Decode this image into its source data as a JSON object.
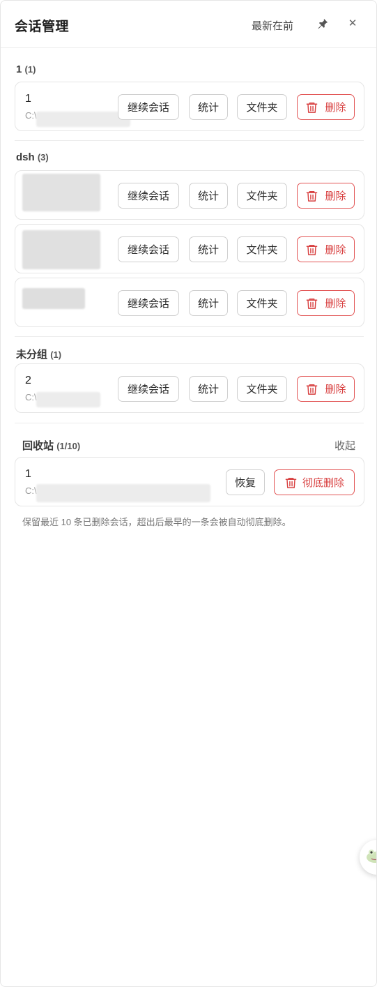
{
  "header": {
    "title": "会话管理",
    "sort_label": "最新在前"
  },
  "buttons": {
    "continue": "继续会话",
    "stats": "统计",
    "folder": "文件夹",
    "delete": "删除"
  },
  "groups": [
    {
      "name": "1",
      "count": "(1)",
      "sessions": [
        {
          "name": "1",
          "path": "C:\\"
        }
      ]
    },
    {
      "name": "dsh",
      "count": "(3)",
      "sessions": [
        {
          "name": "",
          "path": ""
        },
        {
          "name": "",
          "path": ""
        },
        {
          "name": "",
          "path": ""
        }
      ]
    },
    {
      "name": "未分组",
      "count": "(1)",
      "sessions": [
        {
          "name": "2",
          "path": "C:\\"
        }
      ]
    }
  ],
  "recycle_bin": {
    "title": "回收站",
    "count": "(1/10)",
    "collapse_label": "收起",
    "items": [
      {
        "name": "1",
        "path": "C:\\"
      }
    ],
    "restore_label": "恢复",
    "purge_label": "彻底删除",
    "note": "保留最近 10 条已删除会话，超出后最早的一条会被自动彻底删除。"
  },
  "colors": {
    "danger": "#d84040",
    "border": "#e5e5e5"
  },
  "icons": {
    "pin": "pin-icon",
    "close": "close-icon",
    "trash": "trash-icon",
    "assistant": "frog-icon"
  }
}
